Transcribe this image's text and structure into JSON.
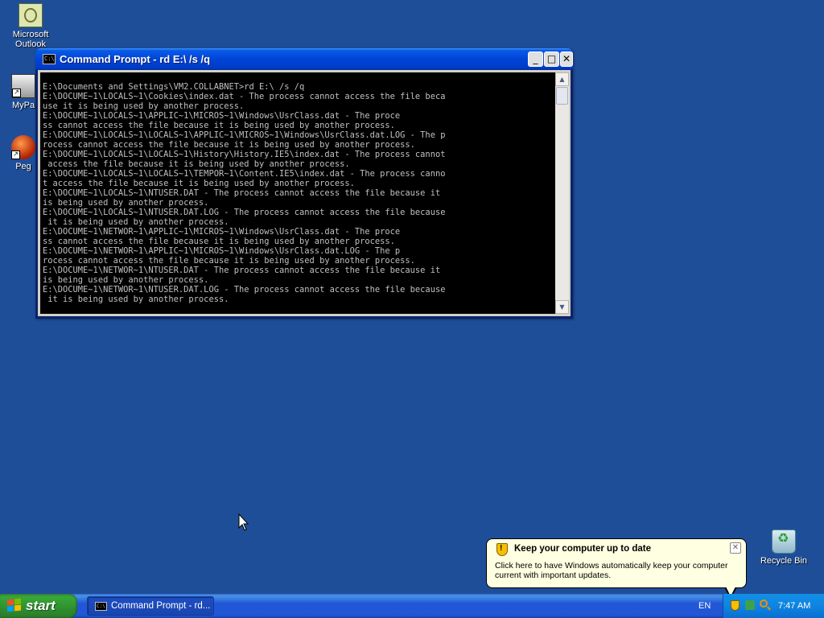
{
  "desktop": {
    "icons": [
      {
        "label": "Microsoft Outlook"
      },
      {
        "label": "MyPa"
      },
      {
        "label": "Peg"
      },
      {
        "label": "Recycle Bin"
      }
    ]
  },
  "window": {
    "title": "Command Prompt - rd E:\\ /s /q",
    "buttons": {
      "minimize": "_",
      "maximize": "□",
      "close": "✕"
    },
    "console_lines": [
      "",
      "E:\\Documents and Settings\\VM2.COLLABNET>rd E:\\ /s /q",
      "E:\\DOCUME~1\\LOCALS~1\\Cookies\\index.dat - The process cannot access the file beca",
      "use it is being used by another process.",
      "E:\\DOCUME~1\\LOCALS~1\\APPLIC~1\\MICROS~1\\Windows\\UsrClass.dat - The proce",
      "ss cannot access the file because it is being used by another process.",
      "E:\\DOCUME~1\\LOCALS~1\\LOCALS~1\\APPLIC~1\\MICROS~1\\Windows\\UsrClass.dat.LOG - The p",
      "rocess cannot access the file because it is being used by another process.",
      "E:\\DOCUME~1\\LOCALS~1\\LOCALS~1\\History\\History.IE5\\index.dat - The process cannot",
      " access the file because it is being used by another process.",
      "E:\\DOCUME~1\\LOCALS~1\\LOCALS~1\\TEMPOR~1\\Content.IE5\\index.dat - The process canno",
      "t access the file because it is being used by another process.",
      "E:\\DOCUME~1\\LOCALS~1\\NTUSER.DAT - The process cannot access the file because it",
      "is being used by another process.",
      "E:\\DOCUME~1\\LOCALS~1\\NTUSER.DAT.LOG - The process cannot access the file because",
      " it is being used by another process.",
      "E:\\DOCUME~1\\NETWOR~1\\APPLIC~1\\MICROS~1\\Windows\\UsrClass.dat - The proce",
      "ss cannot access the file because it is being used by another process.",
      "E:\\DOCUME~1\\NETWOR~1\\APPLIC~1\\MICROS~1\\Windows\\UsrClass.dat.LOG - The p",
      "rocess cannot access the file because it is being used by another process.",
      "E:\\DOCUME~1\\NETWOR~1\\NTUSER.DAT - The process cannot access the file because it",
      "is being used by another process.",
      "E:\\DOCUME~1\\NETWOR~1\\NTUSER.DAT.LOG - The process cannot access the file because",
      " it is being used by another process."
    ]
  },
  "balloon": {
    "title": "Keep your computer up to date",
    "text": "Click here to have Windows automatically keep your computer current with important updates.",
    "close": "✕"
  },
  "taskbar": {
    "start_label": "start",
    "task_label": "Command Prompt - rd...",
    "language": "EN",
    "clock": "7:47 AM"
  },
  "icons": {
    "window": "cmd-icon",
    "balloon": "security-shield-icon",
    "tray": [
      "security-shield-icon",
      "network-icon",
      "search-icon"
    ]
  },
  "colors": {
    "desktop_bg": "#1f4e99",
    "titlebar": "#0044d8",
    "console_bg": "#000000",
    "console_text": "#c0c0c0",
    "balloon_bg": "#ffffe1",
    "start_button": "#2f8f2f"
  }
}
